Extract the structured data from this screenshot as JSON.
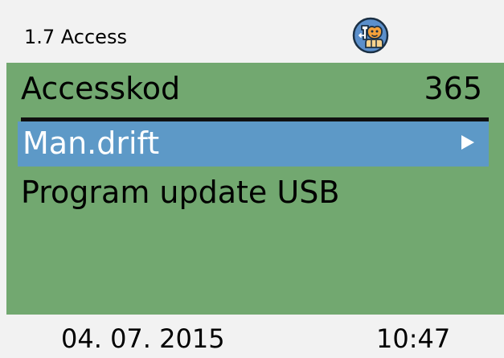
{
  "header": {
    "title": "1.7 Access",
    "icon": "service-technician-icon"
  },
  "menu": {
    "access_code_label": "Accesskod",
    "access_code_value": "365",
    "items": [
      {
        "label": "Man.drift",
        "selected": true
      },
      {
        "label": "Program update USB",
        "selected": false
      }
    ]
  },
  "footer": {
    "date": "04. 07. 2015",
    "time": "10:47"
  },
  "colors": {
    "screen_bg": "#f2f2f2",
    "panel_green": "#72a870",
    "selection_blue": "#5d99c7",
    "icon_blue": "#5b8fcb",
    "icon_orange": "#f4a13a"
  }
}
